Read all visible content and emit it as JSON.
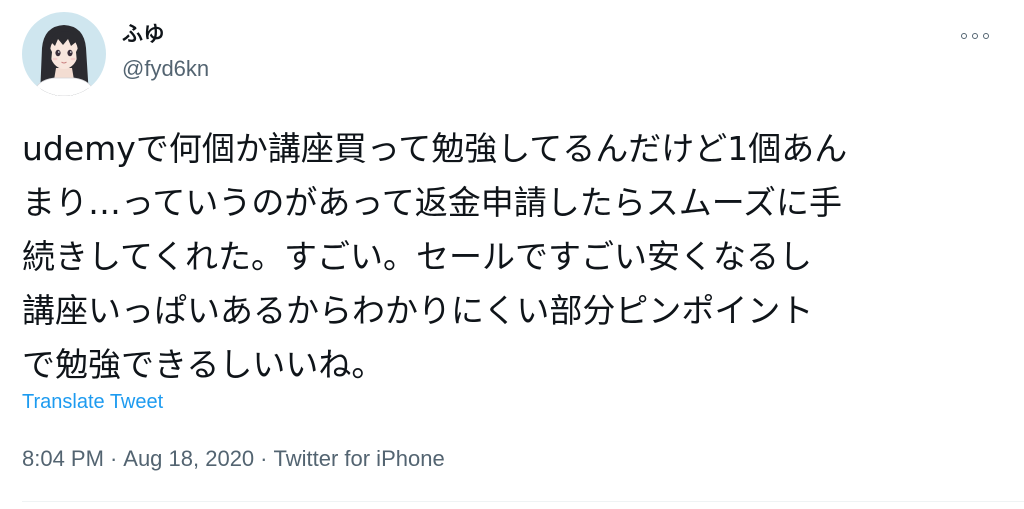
{
  "tweet": {
    "user": {
      "display_name": "ふゆ",
      "handle": "@fyd6kn"
    },
    "text_lines": [
      "udemyで何個か講座買って勉強してるんだけど1個あん",
      "まり…っていうのがあって返金申請したらスムーズに手",
      "続きしてくれた。すごい。セールですごい安くなるし",
      "講座いっぱいあるからわかりにくい部分ピンポイント",
      "で勉強できるしいいね。"
    ],
    "translate_label": "Translate Tweet",
    "timestamp": {
      "time": "8:04 PM",
      "separator_1": "·",
      "date": "Aug 18, 2020",
      "separator_2": "·",
      "source": "Twitter for iPhone"
    }
  },
  "colors": {
    "text_primary": "#0f1419",
    "text_secondary": "#536471",
    "link_blue": "#1d9bf0",
    "avatar_background": "#cfe6ef"
  },
  "icons": {
    "avatar": "anime-girl-avatar",
    "more": "more-horizontal-icon"
  }
}
